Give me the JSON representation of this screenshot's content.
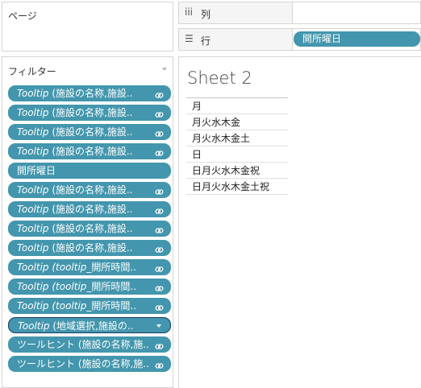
{
  "pages_panel": {
    "title": "ページ"
  },
  "shelves": {
    "columns": {
      "label": "列",
      "icon": "iii"
    },
    "rows": {
      "label": "行",
      "icon": "☰",
      "pill": "開所曜日"
    }
  },
  "filters_panel": {
    "title": "フィルター",
    "pills": [
      {
        "prefix": "Tooltip",
        "text": " (施設の名称,施設..",
        "icon": "link-icon"
      },
      {
        "prefix": "Tooltip",
        "text": " (施設の名称,施設..",
        "icon": "link-icon"
      },
      {
        "prefix": "Tooltip",
        "text": " (施設の名称,施設..",
        "icon": "link-icon"
      },
      {
        "prefix": "Tooltip",
        "text": " (施設の名称,施設..",
        "icon": "link-icon"
      },
      {
        "prefix": "",
        "text": "開所曜日",
        "icon": ""
      },
      {
        "prefix": "Tooltip",
        "text": " (施設の名称,施設..",
        "icon": "link-icon"
      },
      {
        "prefix": "Tooltip",
        "text": " (施設の名称,施設..",
        "icon": "link-icon"
      },
      {
        "prefix": "Tooltip",
        "text": " (施設の名称,施設..",
        "icon": "link-icon"
      },
      {
        "prefix": "Tooltip",
        "text": " (施設の名称,施設..",
        "icon": "link-icon"
      },
      {
        "prefix": "Tooltip (tooltip_",
        "text": "開所時間..",
        "icon": "link-icon"
      },
      {
        "prefix": "Tooltip (tooltip_",
        "text": "開所時間..",
        "icon": "link-icon"
      },
      {
        "prefix": "Tooltip (tooltip_",
        "text": "開所時間..",
        "icon": "link-icon"
      },
      {
        "prefix": "Tooltip",
        "text": " (地域選択,施設の..",
        "icon": "caret-down-icon",
        "active": true
      },
      {
        "prefix": "",
        "text": "ツールヒント (施設の名称,施..",
        "icon": "link-icon"
      },
      {
        "prefix": "",
        "text": "ツールヒント (施設の名称,施..",
        "icon": "link-icon"
      }
    ]
  },
  "view": {
    "title": "Sheet 2",
    "rows": [
      "月",
      "月火水木金",
      "月火水木金土",
      "日",
      "日月火水木金祝",
      "日月火水木金土祝"
    ]
  },
  "colors": {
    "pill": "#4396ad",
    "active_border": "#1a3c66"
  }
}
